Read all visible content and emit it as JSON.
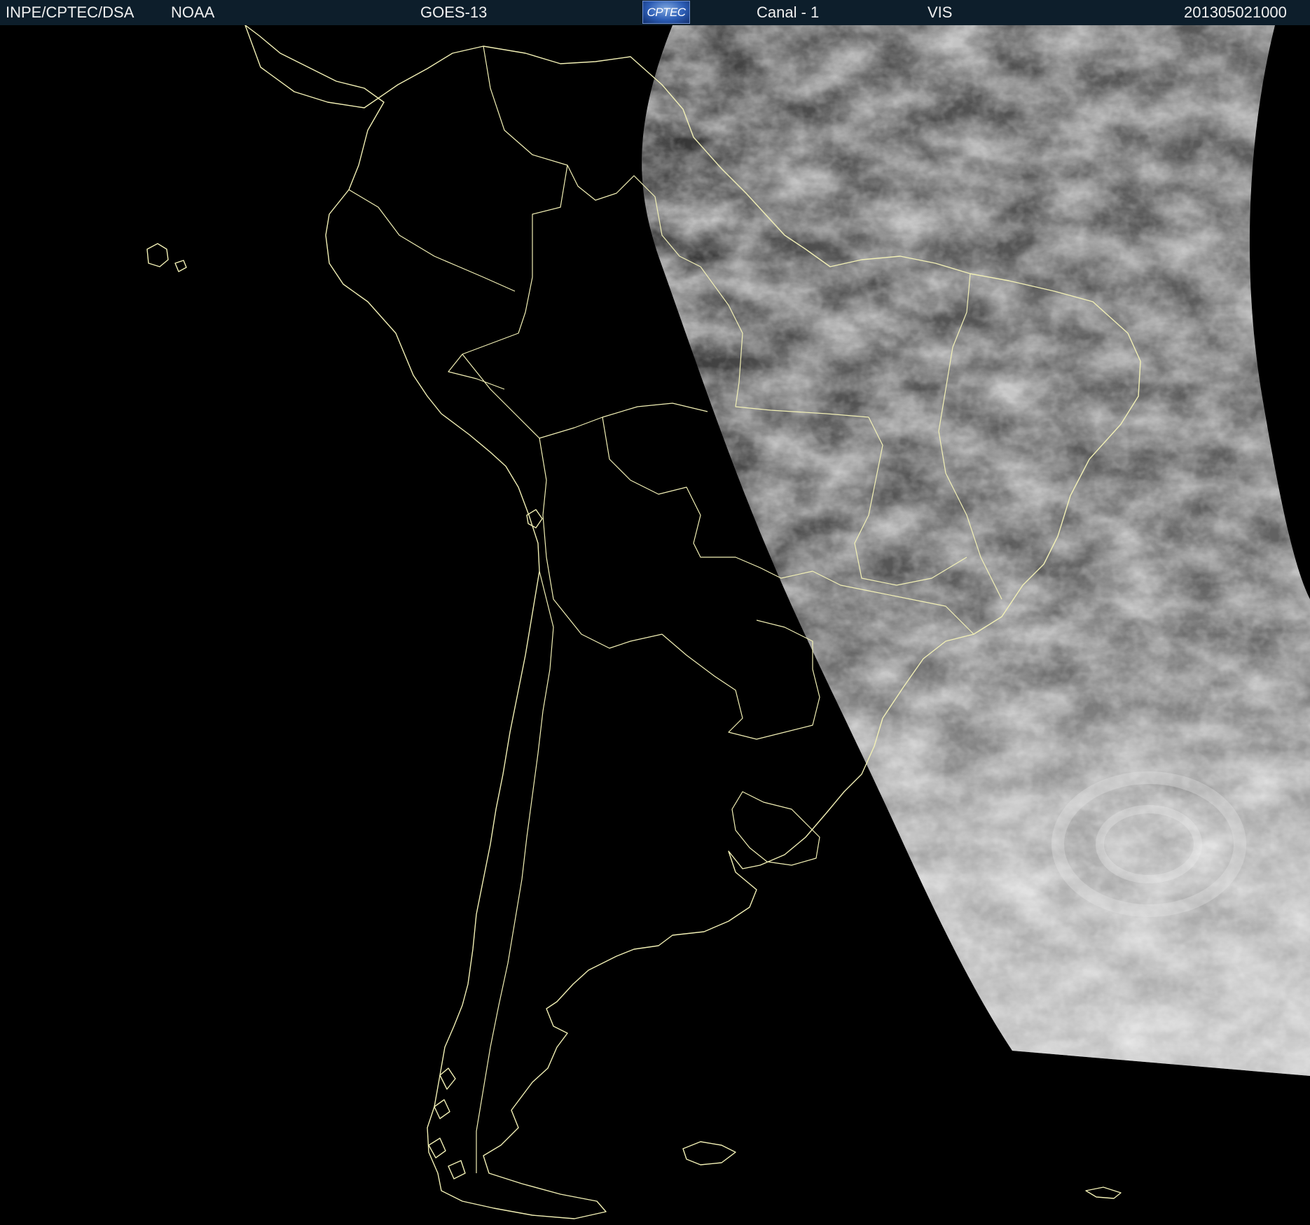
{
  "header": {
    "agency": "INPE/CPTEC/DSA",
    "provider": "NOAA",
    "satellite": "GOES-13",
    "logo_text": "CPTEC",
    "channel": "Canal - 1",
    "band": "VIS",
    "timestamp": "201305021000",
    "background_color": "#0d1e2b",
    "text_color": "#f0f0f0"
  },
  "map": {
    "projection": "satellite visible channel over South America",
    "coastline_color": "#f2f0b5",
    "night_color": "#000000",
    "daylight_imagery": "grayscale cloud imagery on the eastern (right) side of the frame"
  }
}
